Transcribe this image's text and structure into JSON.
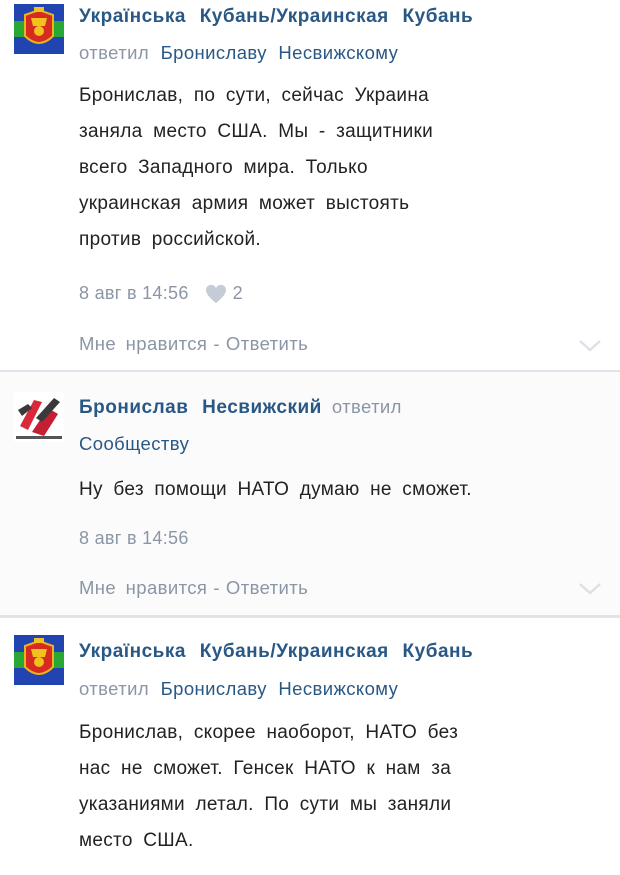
{
  "comments": [
    {
      "author": "Українська Кубань/Украинская Кубань",
      "reply_to_prefix": "ответил",
      "reply_to_name": "Брониславу Несвижскому",
      "lines": [
        "Бронислав, по сути, сейчас Украина",
        "заняла место США. Мы - защитники",
        "всего Западного мира. Только",
        "украинская армия может выстоять",
        "против российской."
      ],
      "timestamp": "8 авг в 14:56",
      "likes": "2",
      "like_label": "Мне нравится",
      "separator": "-",
      "reply_label": "Ответить"
    },
    {
      "author": "Бронислав Несвижский",
      "reply_to_prefix": "ответил",
      "reply_to_name": "Сообществу",
      "lines": [
        "Ну без помощи НАТО думаю не сможет."
      ],
      "timestamp": "8 авг в 14:56",
      "like_label": "Мне нравится",
      "separator": "-",
      "reply_label": "Ответить"
    },
    {
      "author": "Українська Кубань/Украинская Кубань",
      "reply_to_prefix": "ответил",
      "reply_to_name": "Брониславу Несвижскому",
      "lines": [
        "Бронислав, скорее наоборот, НАТО без",
        "нас не сможет. Генсек НАТО к нам за",
        "указаниями летал. По сути мы заняли",
        "место США."
      ]
    }
  ],
  "colors": {
    "link": "#2a5885",
    "muted": "#8a96a5",
    "text": "#222222",
    "divider": "#dfe3ea"
  },
  "icons": {
    "avatar_1": "kuban-coat-of-arms-avatar",
    "avatar_2": "profile-photo-avatar",
    "heart": "heart-icon",
    "chevron": "chevron-down-icon"
  }
}
